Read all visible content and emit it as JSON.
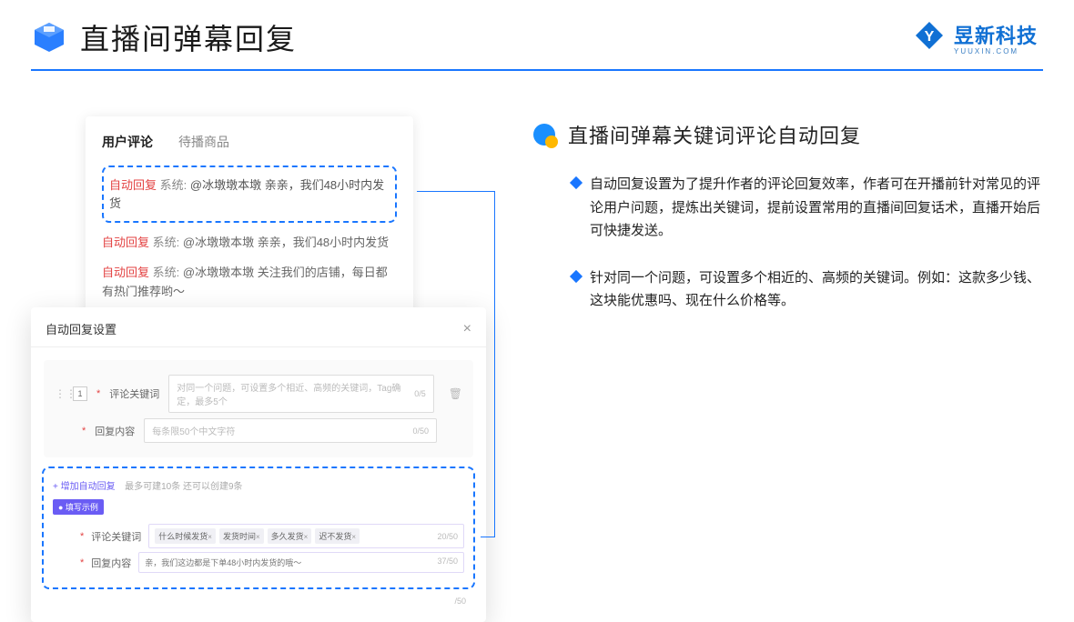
{
  "header": {
    "title": "直播间弹幕回复",
    "brand_name": "昱新科技",
    "brand_sub": "YUUXIN.COM"
  },
  "card_top": {
    "tab_active": "用户评论",
    "tab_inactive": "待播商品",
    "line1_tag": "自动回复",
    "line1_sys": "系统:",
    "line1_text": "@冰墩墩本墩 亲亲，我们48小时内发货",
    "line2_tag": "自动回复",
    "line2_sys": "系统:",
    "line2_text": "@冰墩墩本墩 亲亲，我们48小时内发货",
    "line3_tag": "自动回复",
    "line3_sys": "系统:",
    "line3_text": "@冰墩墩本墩 关注我们的店铺，每日都有热门推荐哟～"
  },
  "modal": {
    "title": "自动回复设置",
    "close": "×",
    "row_num": "1",
    "label_keyword": "评论关键词",
    "placeholder_keyword": "对同一个问题，可设置多个相近、高频的关键词，Tag确定，最多5个",
    "counter_keyword": "0/5",
    "label_content": "回复内容",
    "placeholder_content": "每条限50个中文字符",
    "counter_content": "0/50",
    "add_link": "+ 增加自动回复",
    "add_hint": "最多可建10条 还可以创建9条",
    "example_badge": "● 填写示例",
    "ex_label_keyword": "评论关键词",
    "ex_chip1": "什么时候发货",
    "ex_chip2": "发货时间",
    "ex_chip3": "多久发货",
    "ex_chip4": "迟不发货",
    "ex_counter_keyword": "20/50",
    "ex_label_content": "回复内容",
    "ex_content_text": "亲，我们这边都是下单48小时内发货的哦～",
    "ex_counter_content": "37/50",
    "bottom_counter": "/50"
  },
  "right": {
    "section_title": "直播间弹幕关键词评论自动回复",
    "bullet1": "自动回复设置为了提升作者的评论回复效率，作者可在开播前针对常见的评论用户问题，提炼出关键词，提前设置常用的直播间回复话术，直播开始后可快捷发送。",
    "bullet2": "针对同一个问题，可设置多个相近的、高频的关键词。例如：这款多少钱、这块能优惠吗、现在什么价格等。"
  }
}
